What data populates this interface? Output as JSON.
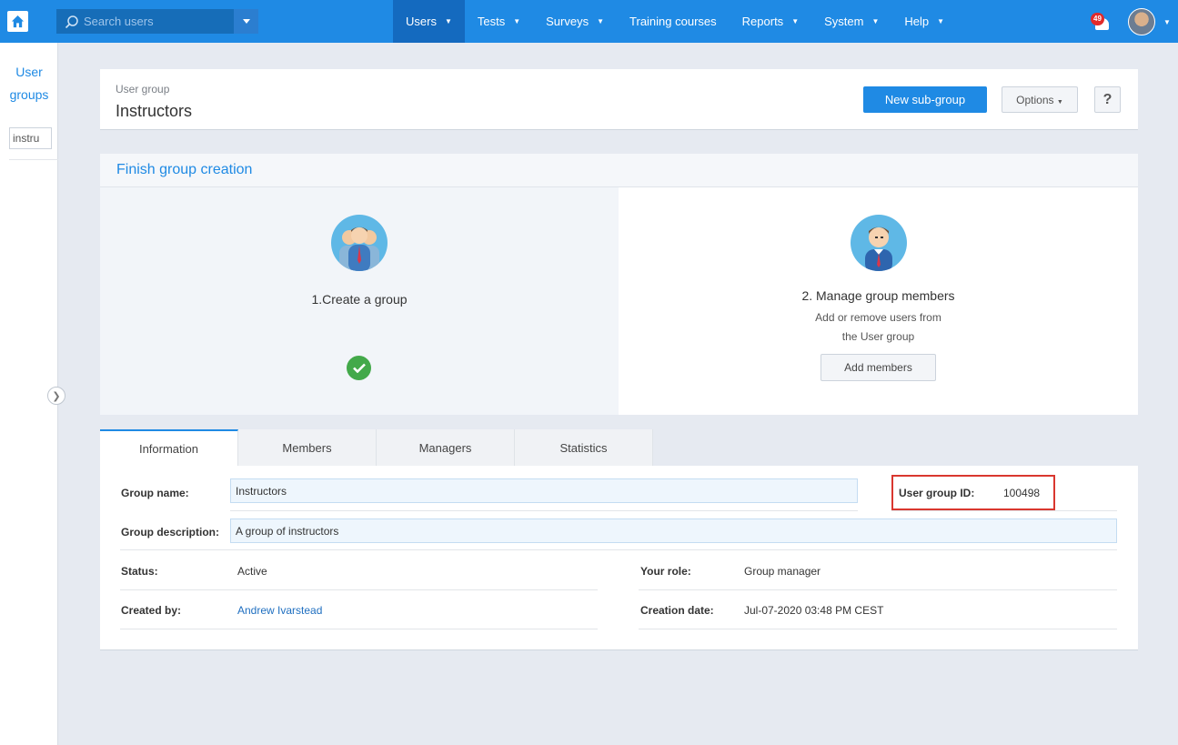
{
  "topbar": {
    "search_placeholder": "Search users",
    "nav": [
      {
        "label": "Users",
        "dropdown": true,
        "active": true
      },
      {
        "label": "Tests",
        "dropdown": true
      },
      {
        "label": "Surveys",
        "dropdown": true
      },
      {
        "label": "Training courses",
        "dropdown": false
      },
      {
        "label": "Reports",
        "dropdown": true
      },
      {
        "label": "System",
        "dropdown": true
      },
      {
        "label": "Help",
        "dropdown": true
      }
    ],
    "notification_count": "49",
    "accent_color": "#1f8ae4"
  },
  "sidebar": {
    "title_line1": "User",
    "title_line2": "groups",
    "search_value": "instru"
  },
  "header": {
    "subtitle": "User group",
    "title": "Instructors",
    "new_subgroup_label": "New sub-group",
    "options_label": "Options",
    "help_label": "?"
  },
  "finish": {
    "title": "Finish group creation",
    "step1_label": "1.Create a group",
    "step2_label": "2. Manage group members",
    "step2_desc_line1": "Add or remove users from",
    "step2_desc_line2": "the User group",
    "add_members_label": "Add members"
  },
  "tabs": [
    "Information",
    "Members",
    "Managers",
    "Statistics"
  ],
  "info": {
    "group_name_label": "Group name:",
    "group_name_value": "Instructors",
    "group_id_label": "User group ID:",
    "group_id_value": "100498",
    "group_desc_label": "Group description:",
    "group_desc_value": "A group of instructors",
    "status_label": "Status:",
    "status_value": "Active",
    "role_label": "Your role:",
    "role_value": "Group manager",
    "created_by_label": "Created by:",
    "created_by_value": "Andrew Ivarstead",
    "creation_date_label": "Creation date:",
    "creation_date_value": "Jul-07-2020 03:48 PM CEST"
  }
}
